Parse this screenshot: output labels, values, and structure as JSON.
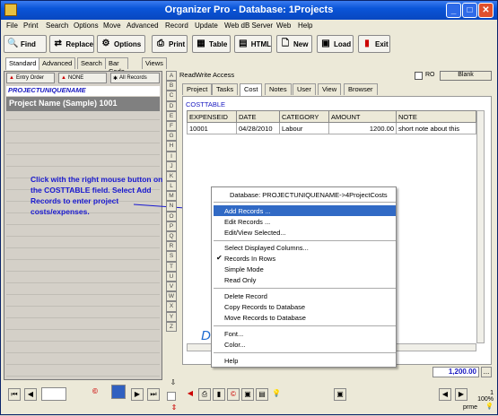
{
  "window": {
    "title": "Organizer Pro - Database: 1Projects"
  },
  "menu": [
    "File",
    "Print",
    "Search",
    "Options",
    "Move",
    "Advanced",
    "Record",
    "Update",
    "Web dB Server",
    "Web",
    "Help"
  ],
  "toolbar": {
    "find": "Find",
    "replace": "Replace",
    "options": "Options",
    "print": "Print",
    "table": "Table",
    "html": "HTML",
    "new": "New",
    "load": "Load",
    "exit": "Exit"
  },
  "view_tabs": [
    "Standard",
    "Advanced",
    "Search",
    "Bar Code",
    "Views"
  ],
  "left": {
    "entry_order": "Entry Order",
    "none": "NONE",
    "all_records": "All Records",
    "field_name": "PROJECTUNIQUENAME",
    "selected_record": "Project Name (Sample) 1001"
  },
  "instruction": "Click with the right mouse button on the COSTTABLE field. Select Add Records to enter project costs/expenses.",
  "alphabet": [
    "A",
    "B",
    "C",
    "D",
    "E",
    "F",
    "G",
    "H",
    "I",
    "J",
    "K",
    "L",
    "M",
    "N",
    "O",
    "P",
    "Q",
    "R",
    "S",
    "T",
    "U",
    "V",
    "W",
    "X",
    "Y",
    "Z"
  ],
  "right": {
    "access": "ReadWrite Access",
    "ro": "RO",
    "blank": "Blank",
    "tabs": [
      "Project",
      "Tasks",
      "Cost",
      "Notes",
      "User",
      "View",
      "Browser"
    ],
    "selected_tab": "Cost",
    "table_label": "COSTTABLE",
    "columns": [
      "EXPENSEID",
      "DATE",
      "CATEGORY",
      "AMOUNT",
      "NOTE"
    ],
    "rows": [
      [
        "10001",
        "04/28/2010",
        "Labour",
        "1200.00",
        "short note about this"
      ]
    ],
    "total": "1,200.00",
    "dots": "...",
    "partial_text": "Do"
  },
  "context_menu": {
    "header": "Database: PROJECTUNIQUENAME->4ProjectCosts",
    "items": [
      "Add Records ...",
      "Edit Records ...",
      "Edit/View Selected...",
      "Select Displayed Columns...",
      "Records In Rows",
      "Simple Mode",
      "Read Only",
      "Delete Record",
      "Copy Records to Database",
      "Move Records to Database",
      "Font...",
      "Color...",
      "Help"
    ],
    "highlighted": "Add Records ...",
    "checked": "Records In Rows"
  },
  "status": {
    "count": "1",
    "zoom": "100%",
    "user": "prme"
  },
  "colors": {
    "titlebar": "#0a55d8",
    "highlight": "#316ac5",
    "link_text": "#1818c0"
  }
}
